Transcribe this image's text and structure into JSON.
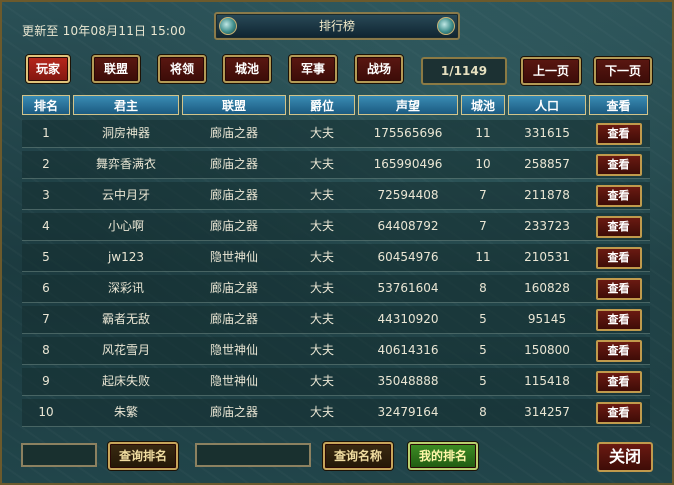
{
  "header": {
    "updated": "更新至 10年08月11日 15:00",
    "title": "排行榜"
  },
  "categories": [
    "玩家",
    "联盟",
    "将领",
    "城池",
    "军事",
    "战场"
  ],
  "pagination": {
    "page": "1/1149",
    "prev": "上一页",
    "next": "下一页"
  },
  "table": {
    "columns": [
      "排名",
      "君主",
      "联盟",
      "爵位",
      "声望",
      "城池",
      "人口",
      "查看"
    ],
    "view_label": "查看",
    "rows": [
      [
        "1",
        "洞房神器",
        "廊庙之器",
        "大夫",
        "175565696",
        "11",
        "331615"
      ],
      [
        "2",
        "舞弈香满衣",
        "廊庙之器",
        "大夫",
        "165990496",
        "10",
        "258857"
      ],
      [
        "3",
        "云中月牙",
        "廊庙之器",
        "大夫",
        "72594408",
        "7",
        "211878"
      ],
      [
        "4",
        "小心啊",
        "廊庙之器",
        "大夫",
        "64408792",
        "7",
        "233723"
      ],
      [
        "5",
        "jw123",
        "隐世神仙",
        "大夫",
        "60454976",
        "11",
        "210531"
      ],
      [
        "6",
        "深彩讯",
        "廊庙之器",
        "大夫",
        "53761604",
        "8",
        "160828"
      ],
      [
        "7",
        "霸者无敌",
        "廊庙之器",
        "大夫",
        "44310920",
        "5",
        "95145"
      ],
      [
        "8",
        "风花雪月",
        "隐世神仙",
        "大夫",
        "40614316",
        "5",
        "150800"
      ],
      [
        "9",
        "起床失败",
        "隐世神仙",
        "大夫",
        "35048888",
        "5",
        "115418"
      ],
      [
        "10",
        "朱繁",
        "廊庙之器",
        "大夫",
        "32479164",
        "8",
        "314257"
      ]
    ]
  },
  "footer": {
    "rank_input": "",
    "query_rank": "查询排名",
    "name_input": "",
    "query_name": "查询名称",
    "my_rank": "我的排名",
    "close": "关闭"
  },
  "colors": {
    "header_blue": "#2d7aa6",
    "button_red": "#5a1711",
    "gold": "#b49a55",
    "green": "#3e8d24"
  }
}
